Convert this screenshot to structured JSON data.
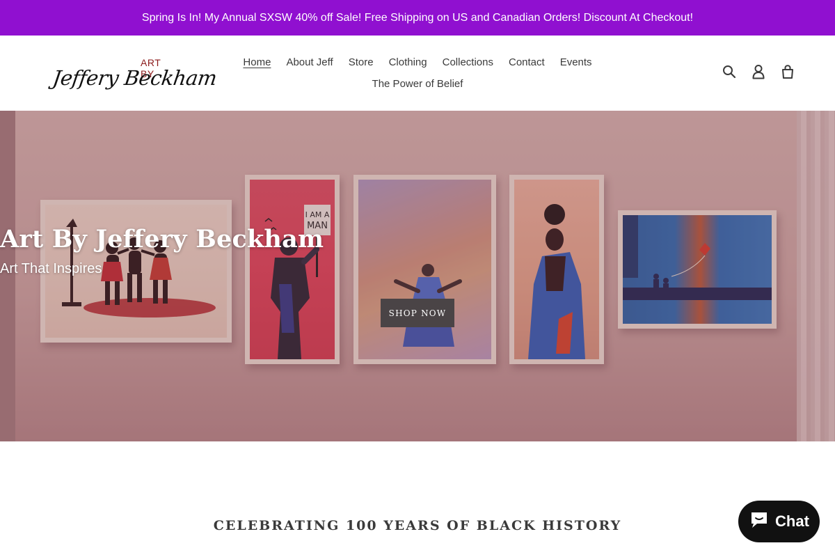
{
  "announcement": {
    "text": "Spring Is In! My Annual SXSW 40% off Sale! Free Shipping on US and Canadian Orders! Discount At Checkout!",
    "background": "#9010d0"
  },
  "header": {
    "logo": {
      "top_text": "ART BY",
      "signature": "Jeffery Beckham"
    },
    "nav": [
      {
        "label": "Home",
        "active": true
      },
      {
        "label": "About Jeff"
      },
      {
        "label": "Store"
      },
      {
        "label": "Clothing"
      },
      {
        "label": "Collections"
      },
      {
        "label": "Contact"
      },
      {
        "label": "Events"
      },
      {
        "label": "The Power of Belief"
      }
    ],
    "icons": [
      "search-icon",
      "account-icon",
      "cart-icon"
    ]
  },
  "hero": {
    "title": "Art By Jeffery Beckham",
    "subtitle": "Art That Inspires",
    "button_label": "SHOP NOW"
  },
  "section": {
    "title": "CELEBRATING 100 YEARS OF BLACK HISTORY"
  },
  "chat": {
    "label": "Chat",
    "background": "#111111"
  }
}
